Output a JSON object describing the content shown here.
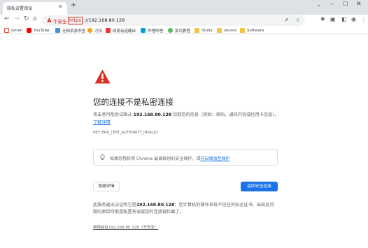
{
  "tab": {
    "title": "隐私设置错误"
  },
  "toolbar": {
    "not_secure": "不安全",
    "url_scheme": "https",
    "url_rest": "://192.168.80.128"
  },
  "bookmarks": [
    {
      "label": "Gmail",
      "icon": "gmail-icon",
      "color": "#ea4335"
    },
    {
      "label": "YouTube",
      "icon": "youtube-icon",
      "color": "#ff0000"
    },
    {
      "label": "无知资源书签",
      "icon": "folder-icon",
      "color": "#4a90d9"
    },
    {
      "label": "力扣",
      "icon": "leetcode-icon",
      "color": "#f89f1b"
    },
    {
      "label": "网易有道翻译",
      "icon": "youdao-icon",
      "color": "#e53935"
    },
    {
      "label": "哔哩哔哩",
      "icon": "bilibili-icon",
      "color": "#00a1d6"
    },
    {
      "label": "菜鸟教程",
      "icon": "runoob-icon",
      "color": "#5cb85c"
    },
    {
      "label": "Study",
      "icon": "folder-icon",
      "color": "#f4c542"
    },
    {
      "label": "source",
      "icon": "folder-icon",
      "color": "#f4c542"
    },
    {
      "label": "Software",
      "icon": "folder-icon",
      "color": "#f4c542"
    }
  ],
  "interstitial": {
    "heading": "您的连接不是私密连接",
    "desc_pre": "攻击者可能会试图从 ",
    "host": "192.168.80.128",
    "desc_post": " 窃取您的信息（例如：密码、通讯内容或信用卡信息）。",
    "learn_more": "了解详情",
    "error_code": "NET::ERR_CERT_AUTHORITY_INVALID",
    "info_pre": "如果您想获得 Chrome 最高级别的安全保护，请",
    "info_link": "开启增强型保护",
    "details_button": "隐藏详情",
    "back_button": "返回安全连接",
    "details_pre": "此服务器无法证明它是",
    "details_host": "192.168.80.128",
    "details_post": "；您计算机的操作系统不信任其安全证书。出现此问题的原因可能是配置有误或您的连接被拦截了。",
    "proceed_link": "继续前往192.168.80.128（不安全）"
  },
  "colors": {
    "accent": "#1a73e8",
    "warning": "#c5221f"
  }
}
